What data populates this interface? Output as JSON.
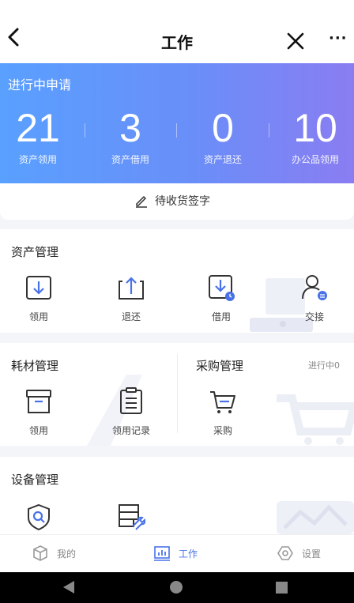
{
  "header": {
    "title": "工作",
    "more": "···"
  },
  "summary": {
    "title": "进行中申请",
    "stats": [
      {
        "value": "21",
        "label": "资产领用"
      },
      {
        "value": "3",
        "label": "资产借用"
      },
      {
        "value": "0",
        "label": "资产退还"
      },
      {
        "value": "10",
        "label": "办公品领用"
      }
    ],
    "pending_sign": "待收货签字"
  },
  "asset_mgmt": {
    "title": "资产管理",
    "items": [
      {
        "label": "领用",
        "icon": "receive-icon"
      },
      {
        "label": "退还",
        "icon": "return-icon"
      },
      {
        "label": "借用",
        "icon": "borrow-icon"
      },
      {
        "label": "交接",
        "icon": "handover-icon"
      }
    ]
  },
  "consumables": {
    "title": "耗材管理",
    "items": [
      {
        "label": "领用",
        "icon": "box-icon"
      },
      {
        "label": "领用记录",
        "icon": "clipboard-icon"
      }
    ]
  },
  "procurement": {
    "title": "采购管理",
    "status": "进行中0",
    "items": [
      {
        "label": "采购",
        "icon": "cart-icon"
      }
    ]
  },
  "equipment": {
    "title": "设备管理",
    "items": [
      {
        "icon": "inspect-icon"
      },
      {
        "icon": "server-wrench-icon"
      }
    ]
  },
  "tabbar": {
    "tabs": [
      {
        "label": "我的",
        "icon": "cube-icon"
      },
      {
        "label": "工作",
        "icon": "chart-icon",
        "active": true
      },
      {
        "label": "设置",
        "icon": "hex-gear-icon"
      }
    ]
  },
  "colors": {
    "accent": "#4a72e8",
    "banner_start": "#59a0ff",
    "banner_end": "#8a7df2"
  }
}
